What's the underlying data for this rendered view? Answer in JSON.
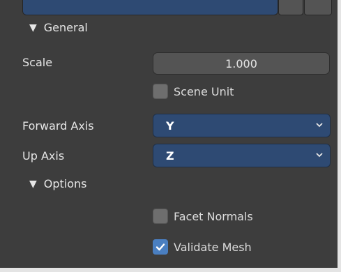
{
  "sections": {
    "general_label": "General",
    "options_label": "Options"
  },
  "scale": {
    "label": "Scale",
    "value": "1.000"
  },
  "scene_unit": {
    "label": "Scene Unit",
    "checked": false
  },
  "forward_axis": {
    "label": "Forward Axis",
    "value": "Y"
  },
  "up_axis": {
    "label": "Up Axis",
    "value": "Z"
  },
  "facet_normals": {
    "label": "Facet Normals",
    "checked": false
  },
  "validate_mesh": {
    "label": "Validate Mesh",
    "checked": true
  },
  "colors": {
    "panel_bg": "#3d3d3d",
    "field_bg": "#545454",
    "select_bg": "#2e4a73",
    "checkbox_on": "#4a7fc1"
  }
}
